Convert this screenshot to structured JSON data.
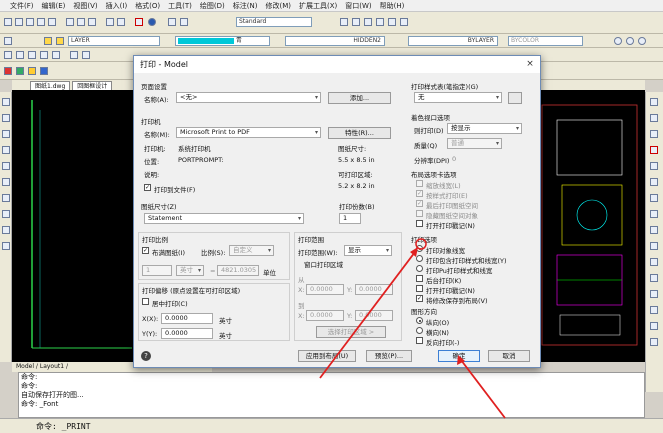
{
  "menubar": {
    "items": [
      "文件(F)",
      "编辑(E)",
      "视图(V)",
      "插入(I)",
      "格式(O)",
      "工具(T)",
      "绘图(D)",
      "标注(N)",
      "修改(M)",
      "扩展工具(X)",
      "窗口(W)",
      "帮助(H)"
    ]
  },
  "toolbar": {
    "text_style": "Standard",
    "layer_name": "LAYER",
    "color_name": "青",
    "linetype_by_layer": "BYLAYER",
    "linetype_hidden": "HIDDEN2",
    "lineweight": "BYCOLOR"
  },
  "tabs": [
    "图纸1.dwg",
    "回图框设计"
  ],
  "layout_tabs": "Model / Layout1 /",
  "command_lines": [
    "命令:",
    "命令:",
    "自动保存打开的图...",
    "命令: _Font"
  ],
  "command_prompt": "命令:  _PRINT",
  "dialog": {
    "title": "打印 - Model",
    "close": "×",
    "page_setup": {
      "header": "页面设置",
      "name_label": "名称(A):",
      "name_value": "<无>",
      "add_button": "添加..."
    },
    "printer": {
      "header": "打印机",
      "name_label": "名称(M):",
      "name_value": "Microsoft Print to PDF",
      "properties_button": "特性(R)...",
      "printer_label": "打印机:",
      "printer_value": "系统打印机",
      "location_label": "位置:",
      "location_value": "PORTPROMPT:",
      "description_label": "说明:",
      "print_to_file": "打印到文件(F)",
      "paper_size_label": "图纸尺寸:",
      "paper_size_value": "5.5 x 8.5 in",
      "printable_label": "可打印区域:",
      "printable_value": "5.2 x 8.2 in"
    },
    "paper_size": {
      "header": "图纸尺寸(Z)",
      "value": "Statement"
    },
    "copies": {
      "header": "打印份数(B)",
      "value": "1"
    },
    "scale": {
      "header": "打印比例",
      "fit_label": "布满图纸(I)",
      "ratio_label": "比例(S):",
      "ratio_value": "自定义",
      "value1": "1",
      "unit": "英寸",
      "value2": "4821.0305",
      "unit_label": "单位"
    },
    "offset": {
      "header": "打印偏移 (原点设置在可打印区域)",
      "center_label": "居中打印(C)",
      "x_label": "X(X):",
      "x_value": "0.0000",
      "y_label": "Y(Y):",
      "y_value": "0.0000",
      "unit": "英寸"
    },
    "area": {
      "header": "打印范围",
      "range_label": "打印范围(W):",
      "range_value": "显示",
      "window_label": "窗口打印区域",
      "from_label": "从",
      "to_label": "到",
      "x_label": "X:",
      "y_label": "Y:",
      "x1": "0.0000",
      "y1": "0.0000",
      "x2": "0.0000",
      "y2": "0.0000",
      "select_button": "选择打印区域 >"
    },
    "style_table": {
      "header": "打印样式表(笔指定)(G)",
      "value": "无"
    },
    "viewport": {
      "header": "着色视口选项",
      "shade_label": "则打印(D)",
      "shade_value": "按显示",
      "quality_label": "质量(Q)",
      "quality_value": "普通",
      "dpi_label": "分辨率(DPI)",
      "dpi_value": "0"
    },
    "layout_options": {
      "header": "布局选项卡选项",
      "items": [
        "缩放线宽(L)",
        "按样式打印(E)",
        "最后打印图纸空间",
        "隐藏图纸空间对象",
        "打开打印戳记(N)"
      ]
    },
    "print_options": {
      "header": "打印选项",
      "items": [
        "打印对象线宽",
        "打印包含打印样式和线宽(Y)",
        "打印Pu打印样式和线宽",
        "后台打印(K)",
        "打开打印戳记(N)",
        "将修改保存到布局(V)"
      ]
    },
    "orientation": {
      "header": "图形方向",
      "items": [
        "纵向(O)",
        "横向(N)",
        "反向打印(-)"
      ]
    },
    "buttons": {
      "apply": "应用到布局(U)",
      "preview": "预览(P)...",
      "ok": "确定",
      "cancel": "取消"
    }
  }
}
